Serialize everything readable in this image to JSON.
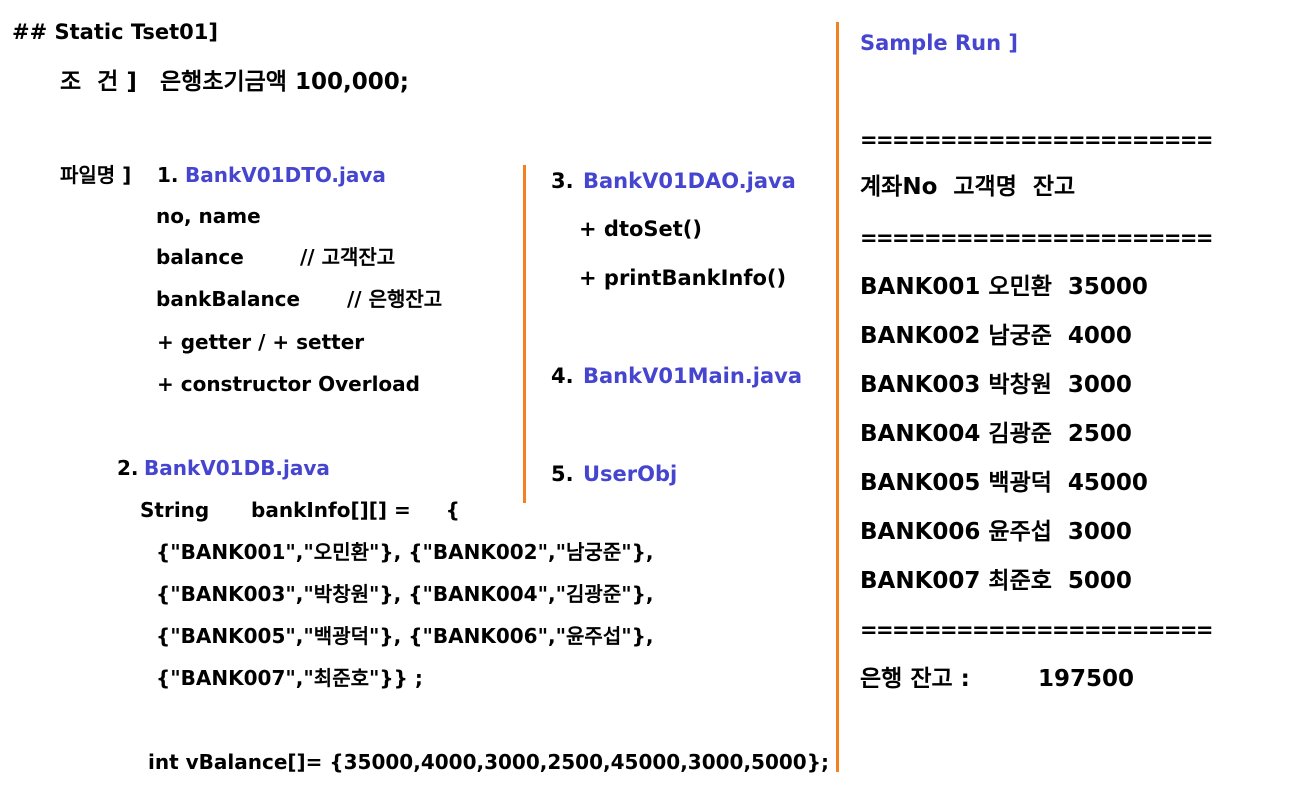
{
  "title": "## Static Tset01]",
  "condition": {
    "label": "조  건 ]",
    "text": "은행초기금액 100,000;"
  },
  "files_label": "파일명 ]",
  "dto": {
    "num": "1.",
    "name": "BankV01DTO.java",
    "lines": [
      {
        "field": "no, name",
        "comment": ""
      },
      {
        "field": "balance",
        "comment": "// 고객잔고"
      },
      {
        "field": "bankBalance",
        "comment": "// 은행잔고"
      },
      {
        "field": "+ getter / + setter",
        "comment": ""
      },
      {
        "field": "+ constructor Overload",
        "comment": ""
      }
    ]
  },
  "db": {
    "num": "2.",
    "name": "BankV01DB.java",
    "decl": "String      bankInfo[][] =     {",
    "rows": [
      "{\"BANK001\",\"오민환\"}, {\"BANK002\",\"남궁준\"},",
      "{\"BANK003\",\"박창원\"}, {\"BANK004\",\"김광준\"},",
      "{\"BANK005\",\"백광덕\"}, {\"BANK006\",\"윤주섭\"},",
      "{\"BANK007\",\"최준호\"}} ;"
    ],
    "balance_decl": "int vBalance[]= {35000,4000,3000,2500,45000,3000,5000};"
  },
  "dao": {
    "num": "3.",
    "name": "BankV01DAO.java",
    "methods": [
      "+ dtoSet()",
      "+ printBankInfo()"
    ]
  },
  "main": {
    "num": "4.",
    "name": "BankV01Main.java"
  },
  "userobj": {
    "num": "5.",
    "name": "UserObj"
  },
  "sample": {
    "title": "Sample Run ]",
    "separator": "======================",
    "header": "계좌No  고객명  잔고",
    "rows": [
      "BANK001 오민환  35000",
      "BANK002 남궁준  4000",
      "BANK003 박창원  3000",
      "BANK004 김광준  2500",
      "BANK005 백광덕  45000",
      "BANK006 윤주섭  3000",
      "BANK007 최준호  5000"
    ],
    "total_label": "은행 잔고 :",
    "total_value": "197500"
  },
  "colors": {
    "accent_blue": "#4545d0",
    "divider_orange": "#f5801f"
  }
}
